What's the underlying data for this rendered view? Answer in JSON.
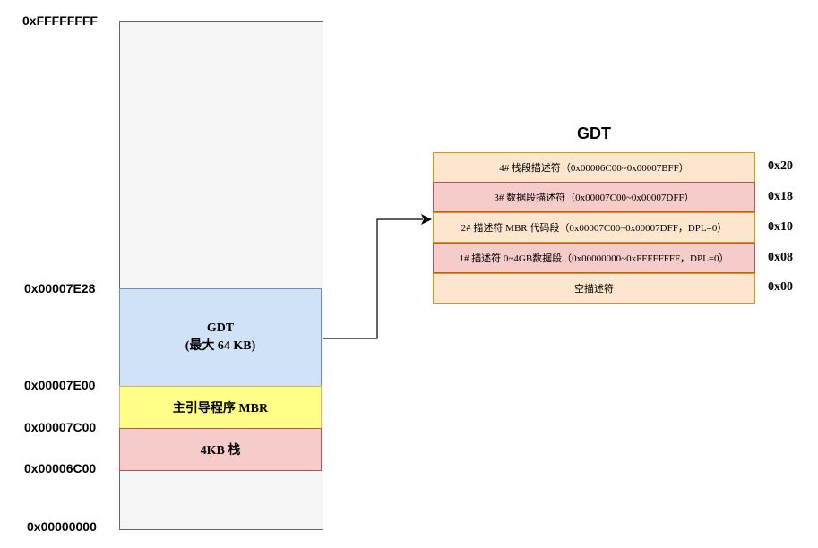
{
  "memory": {
    "addresses": {
      "top": "0xFFFFFFFF",
      "gdt_start": "0x00007E28",
      "gdt_base": "0x00007E00",
      "mbr_base": "0x00007C00",
      "stack_base": "0x00006C00",
      "bottom": "0x00000000"
    },
    "segments": {
      "gdt": {
        "title": "GDT",
        "subtitle": "(最大 64 KB)",
        "color": "#cfe2f8"
      },
      "mbr": {
        "label": "主引导程序 MBR",
        "color": "#ffff88"
      },
      "stack": {
        "label": "4KB 栈",
        "color": "#f6cccb"
      }
    }
  },
  "gdt": {
    "title": "GDT",
    "rows": [
      {
        "label": "4# 栈段描述符（0x00006C00~0x00007BFF）",
        "selector": "0x20",
        "color": "#fde6cd"
      },
      {
        "label": "3# 数据段描述符（0x00007C00~0x00007DFF）",
        "selector": "0x18",
        "color": "#f6cccb"
      },
      {
        "label": "2# 描述符 MBR 代码段（0x00007C00~0x00007DFF，DPL=0）",
        "selector": "0x10",
        "color": "#fde6cd"
      },
      {
        "label": "1# 描述符  0~4GB数据段（0x00000000~0xFFFFFFFF，DPL=0）",
        "selector": "0x08",
        "color": "#f6cccb"
      },
      {
        "label": "空描述符",
        "selector": "0x00",
        "color": "#fde6cd"
      }
    ]
  }
}
